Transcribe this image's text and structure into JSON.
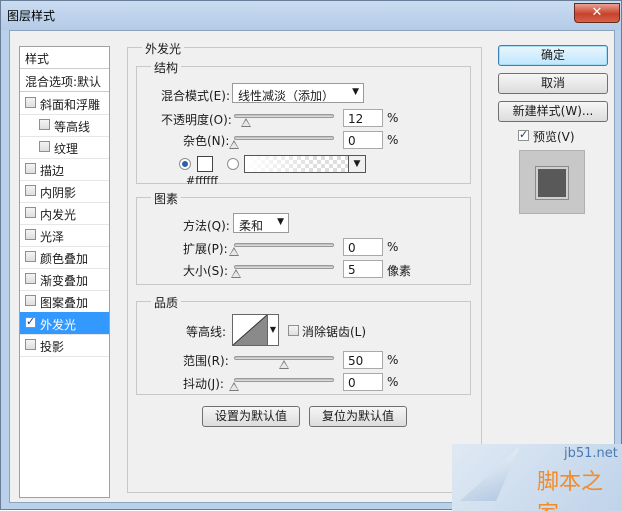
{
  "window": {
    "title": "图层样式",
    "close_glyph": "✕"
  },
  "list": {
    "header": "样式",
    "blend_options": "混合选项:默认",
    "items": [
      {
        "label": "斜面和浮雕",
        "checked": false
      },
      {
        "label": "等高线",
        "checked": false
      },
      {
        "label": "纹理",
        "checked": false
      },
      {
        "label": "描边",
        "checked": false
      },
      {
        "label": "内阴影",
        "checked": false
      },
      {
        "label": "内发光",
        "checked": false
      },
      {
        "label": "光泽",
        "checked": false
      },
      {
        "label": "颜色叠加",
        "checked": false
      },
      {
        "label": "渐变叠加",
        "checked": false
      },
      {
        "label": "图案叠加",
        "checked": false
      },
      {
        "label": "外发光",
        "checked": true
      },
      {
        "label": "投影",
        "checked": false
      }
    ]
  },
  "panel": {
    "title": "外发光",
    "structure": {
      "title": "结构",
      "blend_mode_label": "混合模式(E):",
      "blend_mode_value": "线性减淡（添加）",
      "opacity_label": "不透明度(O):",
      "opacity_value": "12",
      "noise_label": "杂色(N):",
      "noise_value": "0",
      "percent": "%",
      "color_hex": "#ffffff"
    },
    "elements": {
      "title": "图素",
      "technique_label": "方法(Q):",
      "technique_value": "柔和",
      "spread_label": "扩展(P):",
      "spread_value": "0",
      "size_label": "大小(S):",
      "size_value": "5",
      "percent": "%",
      "size_unit": "像素"
    },
    "quality": {
      "title": "品质",
      "contour_label": "等高线:",
      "antialias_label": "消除锯齿(L)",
      "range_label": "范围(R):",
      "range_value": "50",
      "jitter_label": "抖动(J):",
      "jitter_value": "0",
      "percent": "%"
    },
    "make_default": "设置为默认值",
    "reset_default": "复位为默认值"
  },
  "buttons": {
    "ok": "确定",
    "cancel": "取消",
    "new_style": "新建样式(W)...",
    "preview_label": "预览(V)",
    "preview_checked": true
  },
  "sliders": {
    "opacity": 0.12,
    "noise": 0,
    "spread": 0,
    "size": 0.02,
    "range": 0.5,
    "jitter": 0
  },
  "watermark": {
    "url": "jb51.net",
    "name": "脚本之家"
  },
  "colors": {
    "selection": "#3399ff",
    "title_bar": "#b9d1ea",
    "close": "#c7432b",
    "glow": "#ffffff"
  }
}
